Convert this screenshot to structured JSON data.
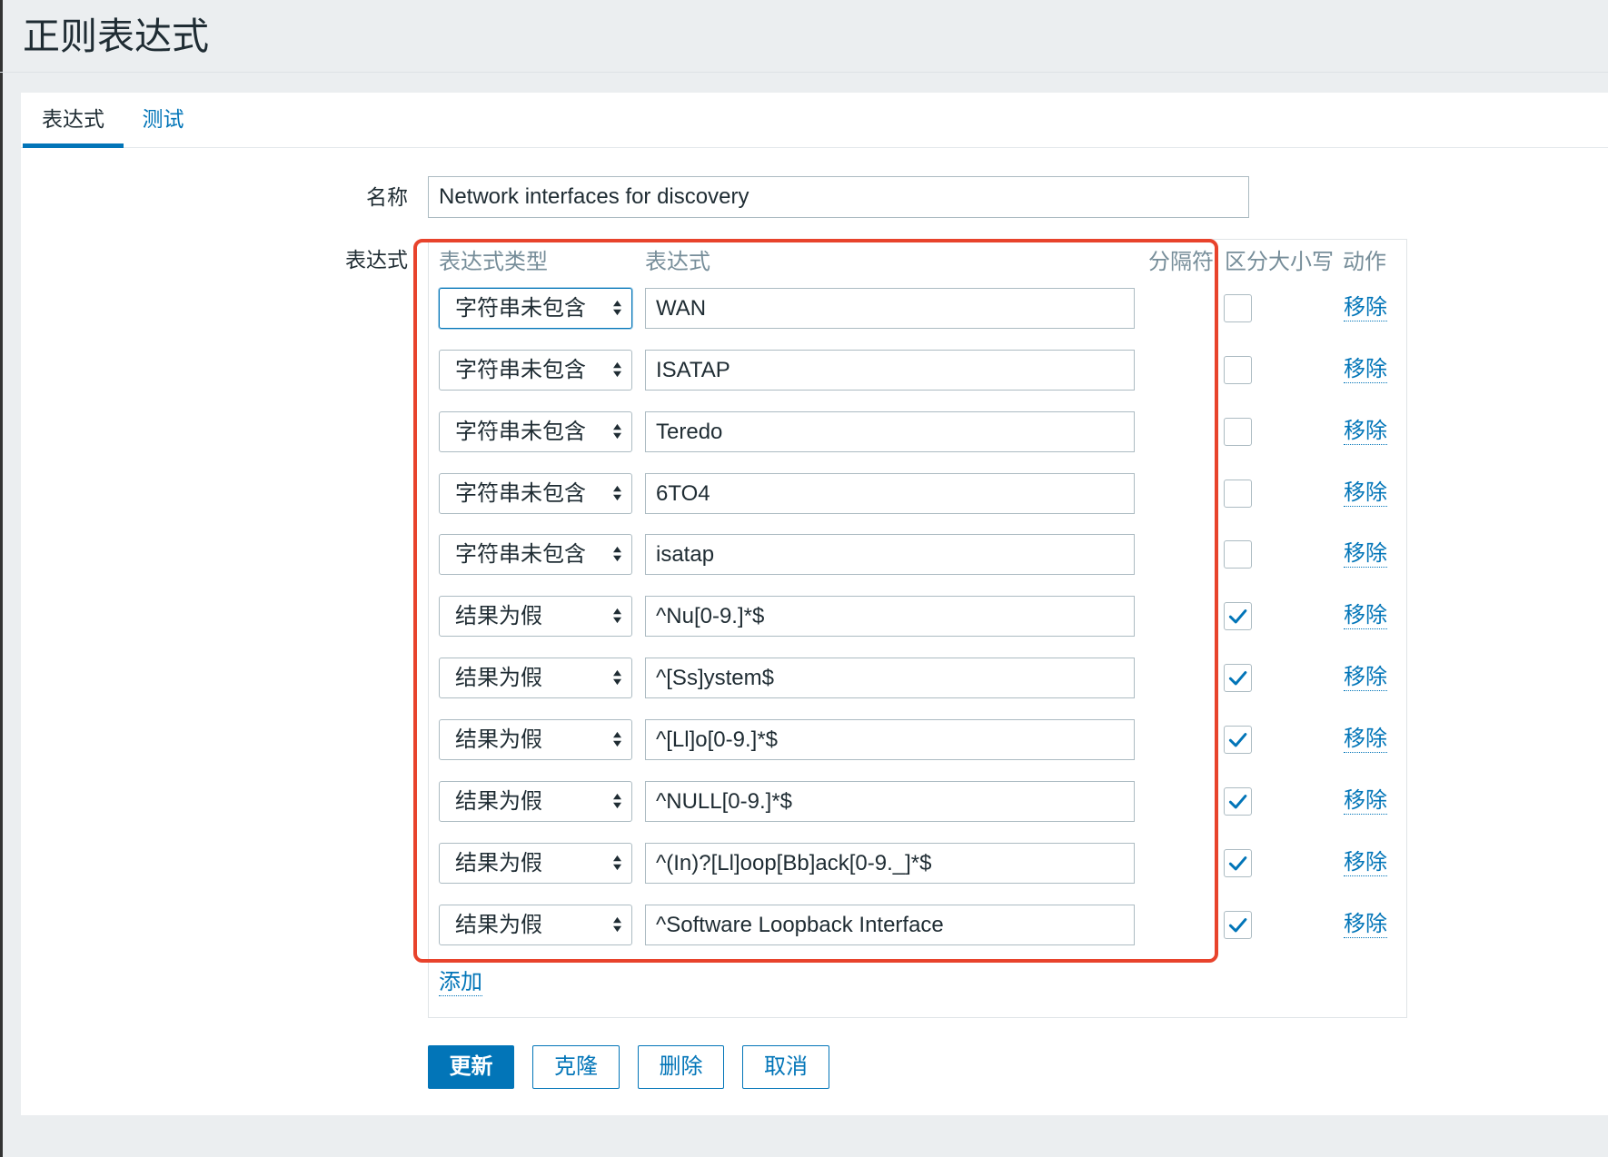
{
  "page": {
    "title": "正则表达式"
  },
  "tabs": [
    {
      "label": "表达式",
      "active": true
    },
    {
      "label": "测试",
      "active": false
    }
  ],
  "form": {
    "name_label": "名称",
    "name_value": "Network interfaces for discovery",
    "expressions_label": "表达式"
  },
  "expressions": {
    "headers": {
      "type": "表达式类型",
      "expression": "表达式",
      "delimiter": "分隔符",
      "case_sensitive": "区分大小写",
      "action": "动作"
    },
    "remove_label": "移除",
    "add_label": "添加",
    "rows": [
      {
        "type": "字符串未包含",
        "expression": "WAN",
        "case_sensitive": false
      },
      {
        "type": "字符串未包含",
        "expression": "ISATAP",
        "case_sensitive": false
      },
      {
        "type": "字符串未包含",
        "expression": "Teredo",
        "case_sensitive": false
      },
      {
        "type": "字符串未包含",
        "expression": "6TO4",
        "case_sensitive": false
      },
      {
        "type": "字符串未包含",
        "expression": "isatap",
        "case_sensitive": false
      },
      {
        "type": "结果为假",
        "expression": "^Nu[0-9.]*$",
        "case_sensitive": true
      },
      {
        "type": "结果为假",
        "expression": "^[Ss]ystem$",
        "case_sensitive": true
      },
      {
        "type": "结果为假",
        "expression": "^[Ll]o[0-9.]*$",
        "case_sensitive": true
      },
      {
        "type": "结果为假",
        "expression": "^NULL[0-9.]*$",
        "case_sensitive": true
      },
      {
        "type": "结果为假",
        "expression": "^(In)?[Ll]oop[Bb]ack[0-9._]*$",
        "case_sensitive": true
      },
      {
        "type": "结果为假",
        "expression": "^Software Loopback Interface",
        "case_sensitive": true
      }
    ]
  },
  "buttons": {
    "update": "更新",
    "clone": "克隆",
    "delete": "删除",
    "cancel": "取消"
  },
  "icons": {
    "select_arrows": "select-arrows-icon",
    "checkmark": "checkmark-icon"
  },
  "colors": {
    "accent": "#0275b8",
    "text": "#1f2c33",
    "header_text": "#768d99",
    "page_background": "#ebeef0",
    "annotation": "#e8432c"
  }
}
